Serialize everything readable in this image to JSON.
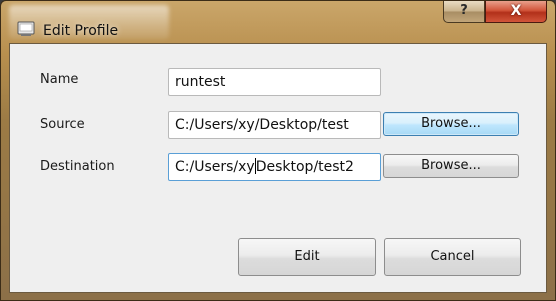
{
  "window": {
    "title": "Edit Profile",
    "help_label": "?",
    "close_label": "X"
  },
  "form": {
    "name_label": "Name",
    "name_value": "runtest",
    "source_label": "Source",
    "source_value": "C:/Users/xy/Desktop/test",
    "destination_label": "Destination",
    "destination_before_caret": "C:/Users/xy",
    "destination_after_caret": "Desktop/test2",
    "browse_label": "Browse..."
  },
  "actions": {
    "edit_label": "Edit",
    "cancel_label": "Cancel"
  },
  "icons": {
    "app": "app-window-icon"
  }
}
